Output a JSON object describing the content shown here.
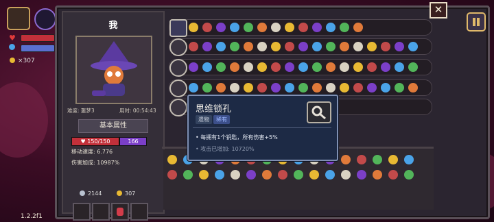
{
  "hud": {
    "coin_label": "×307"
  },
  "version": "1.2.2f1",
  "character": {
    "name": "我",
    "difficulty": "难度: 噩梦3",
    "time": "用时: 00:54:43",
    "section_button": "基本属性",
    "hp": "150/150",
    "shield": "166",
    "move_speed": "移动速度: 6.776",
    "damage_bonus": "伤害加成: 10987%",
    "keys": "2144",
    "coins": "307"
  },
  "tooltip": {
    "title": "思维锁孔",
    "tag_type": "遗物",
    "tag_rarity": "稀有",
    "effect": "每拥有1个钥匙，所有伤害+5%",
    "stat": "攻击已增加: 10720%"
  },
  "colors": {
    "hp": "#c2303a",
    "shield": "#7b3fc8",
    "tooltip_bg": "#1d2a45",
    "rarity_tag": "#3c4f8a",
    "effect_text": "#e9eef8",
    "stat_text": "#8f9ab0"
  },
  "icons": [
    "treasure-chest-icon",
    "heart-icon",
    "shield-icon",
    "coin-icon",
    "key-icon",
    "close-icon",
    "pause-icon",
    "magnifier-key-icon"
  ]
}
